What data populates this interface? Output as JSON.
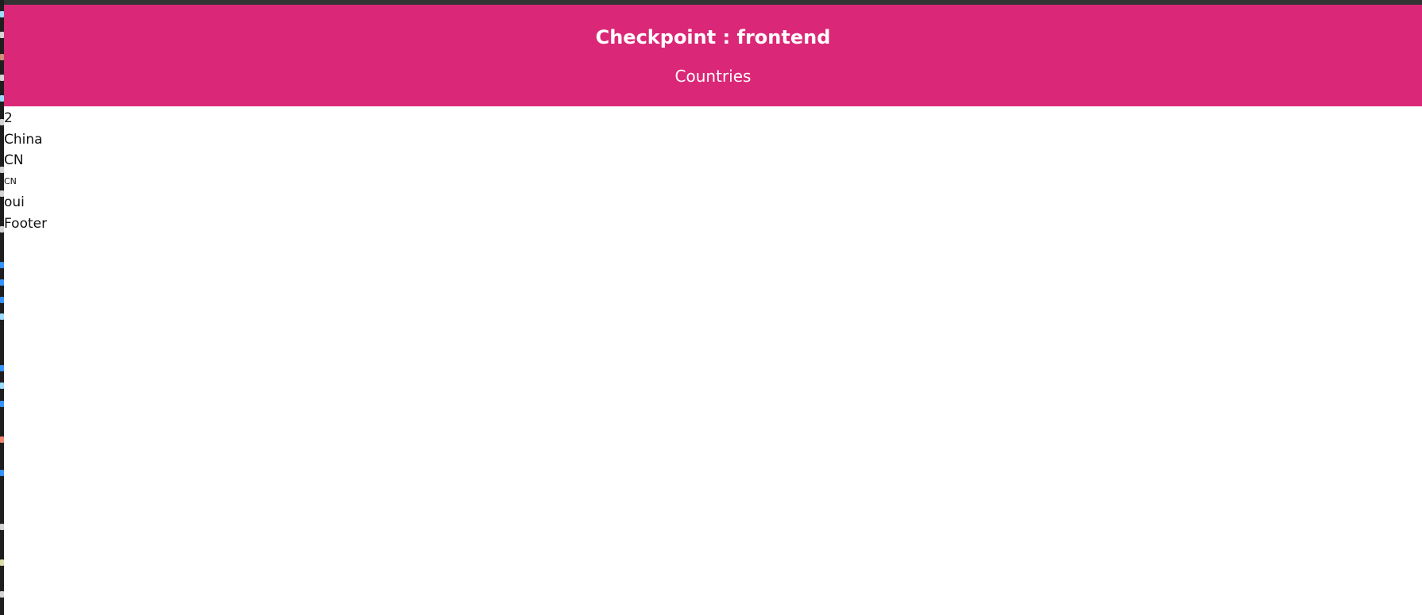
{
  "colors": {
    "header_bg": "#db2777",
    "header_text": "#ffffff",
    "body_text": "#111111"
  },
  "header": {
    "title": "Checkpoint : frontend",
    "subtitle": "Countries"
  },
  "country": {
    "id": "2",
    "name": "China",
    "code": "CN",
    "code_small": "CN",
    "flag_text": "oui"
  },
  "footer": {
    "text": "Footer"
  }
}
